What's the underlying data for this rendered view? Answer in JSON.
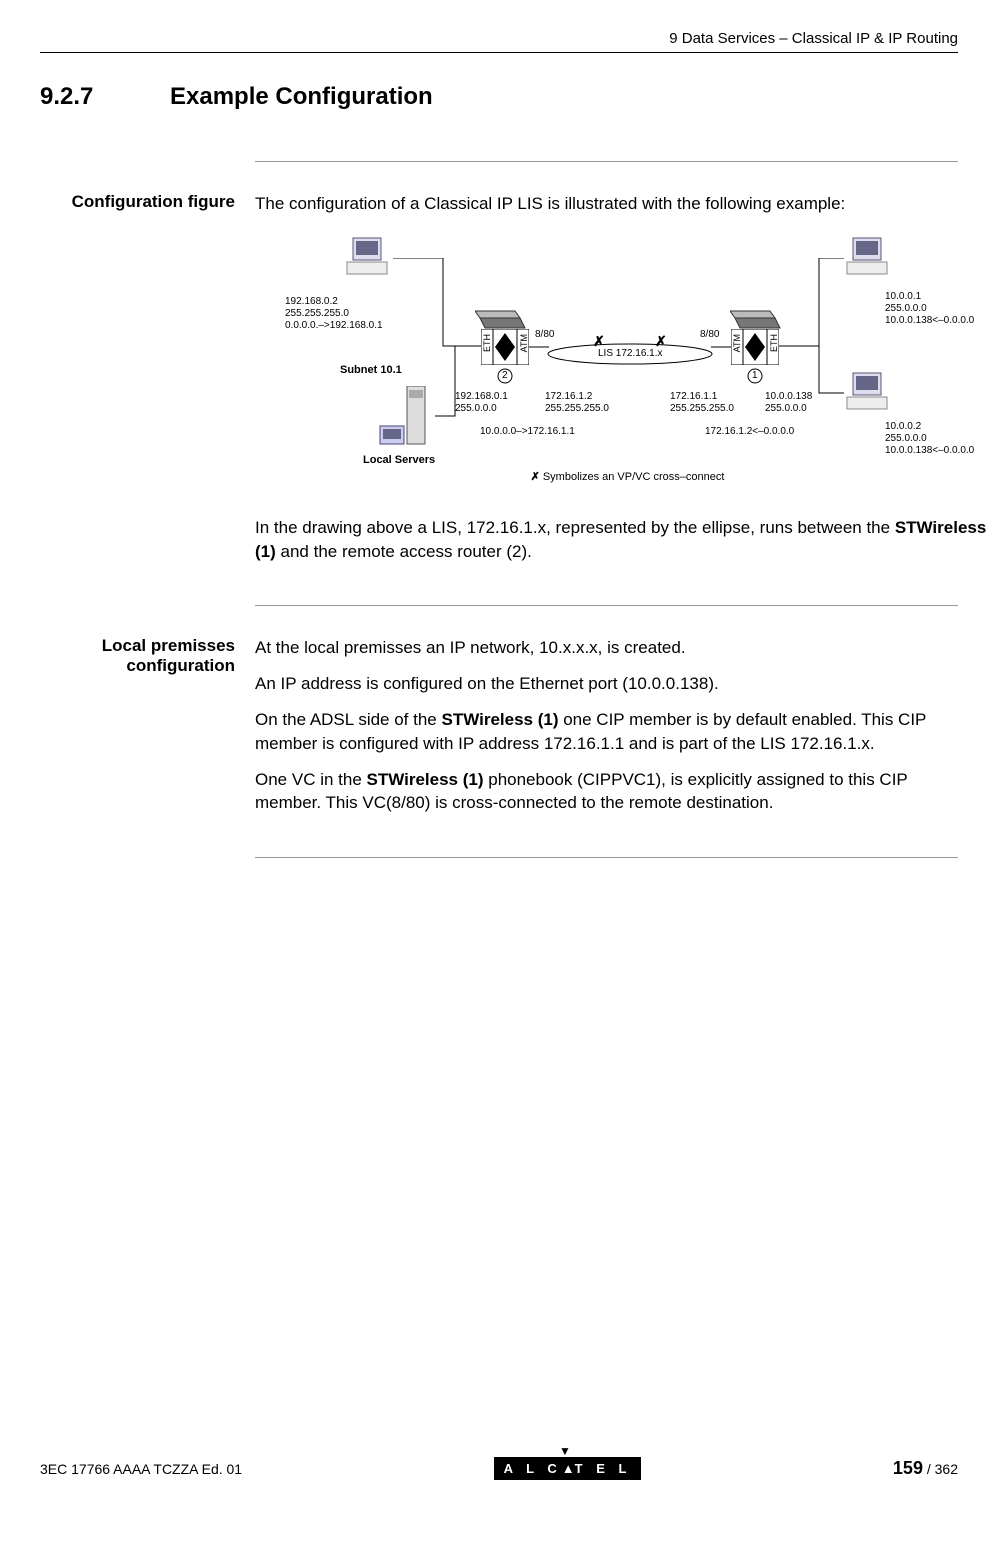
{
  "header": {
    "chapter": "9   Data Services – Classical IP & IP Routing"
  },
  "section": {
    "number": "9.2.7",
    "title": "Example Configuration"
  },
  "block1": {
    "label": "Configuration figure",
    "intro": "The configuration of a Classical IP LIS is illustrated with the following example:",
    "desc_a": "In the drawing above a LIS, 172.16.1.x, represented by the ellipse, runs between the ",
    "desc_b": "STWireless (1)",
    "desc_c": " and the remote access router (2)."
  },
  "diagram": {
    "pc_left_ip": "192.168.0.2\n255.255.255.0\n0.0.0.0.–>192.168.0.1",
    "subnet_label": "Subnet 10.1",
    "local_servers": "Local Servers",
    "router2_eth": "192.168.0.1\n255.0.0.0",
    "router2_atm": "172.16.1.2\n255.255.255.0",
    "router2_route": "10.0.0.0–>172.16.1.1",
    "vc_left": "8/80",
    "vc_right": "8/80",
    "lis_label": "LIS 172.16.1.x",
    "symbolize": "Symbolizes an VP/VC cross–connect",
    "router1_atm": "172.16.1.1\n255.255.255.0",
    "router1_eth": "10.0.0.138\n255.0.0.0",
    "router1_route": "172.16.1.2<–0.0.0.0",
    "pc_right1": "10.0.0.1\n255.0.0.0\n10.0.0.138<–0.0.0.0",
    "pc_right2": "10.0.0.2\n255.0.0.0\n10.0.0.138<–0.0.0.0",
    "eth_label": "ETH",
    "atm_label": "ATM",
    "badge1": "1",
    "badge2": "2",
    "cross": "✗"
  },
  "block2": {
    "label": "Local premisses configuration",
    "p1": "At the local premisses an IP network, 10.x.x.x,  is created.",
    "p2": "An IP address is configured on the Ethernet port (10.0.0.138).",
    "p3a": "On the ADSL side of the ",
    "p3b": "STWireless (1)",
    "p3c": " one CIP member is by default enabled. This CIP member is configured with IP address 172.16.1.1 and is part of the LIS 172.16.1.x.",
    "p4a": "One VC in the ",
    "p4b": "STWireless (1)",
    "p4c": " phonebook (CIPPVC1), is explicitly assigned to this CIP member. This VC(8/80) is cross-connected to the remote destination."
  },
  "footer": {
    "docref": "3EC 17766 AAAA TCZZA Ed. 01",
    "logo": "A L C ▲ T E L",
    "page_current": "159",
    "page_sep": " / ",
    "page_total": "362"
  }
}
